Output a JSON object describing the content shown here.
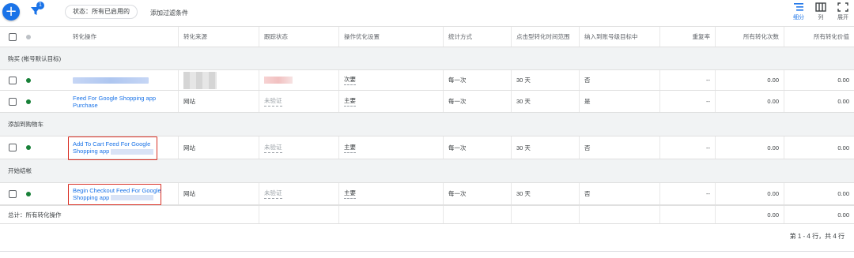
{
  "toolbar": {
    "filter_badge": "1",
    "status_chip": "状态：所有已启用的",
    "add_filter": "添加过滤条件",
    "tools": [
      {
        "label": "细分",
        "icon": "segment-icon"
      },
      {
        "label": "列",
        "icon": "columns-icon"
      },
      {
        "label": "展开",
        "icon": "expand-icon"
      }
    ]
  },
  "colors": {
    "accent": "#1a73e8",
    "status_active": "#188038",
    "highlight_box": "#d93025"
  },
  "columns": [
    "转化操作",
    "转化来源",
    "跟踪状态",
    "操作优化设置",
    "统计方式",
    "点击型转化时间范围",
    "纳入到账号级目标中",
    "重复率",
    "所有转化次数",
    "所有转化价值"
  ],
  "groups": [
    {
      "label": "购买 (帐号默认目标)",
      "rows": [
        {
          "name_line1": "",
          "name_line2": "",
          "source": "",
          "tracking": "",
          "optimization": "次要",
          "count": "每一次",
          "window": "30 天",
          "in_goal": "否",
          "repeat": "--",
          "conversions": "0.00",
          "value": "0.00"
        },
        {
          "name_line1": "Feed For Google Shopping app",
          "name_line2": "Purchase",
          "source": "网站",
          "tracking": "未验证",
          "optimization": "主要",
          "count": "每一次",
          "window": "30 天",
          "in_goal": "是",
          "repeat": "--",
          "conversions": "0.00",
          "value": "0.00"
        }
      ]
    },
    {
      "label": "添加到购物车",
      "rows": [
        {
          "name_line1": "Add To Cart Feed For Google",
          "name_line2": "Shopping app",
          "source": "网站",
          "tracking": "未验证",
          "optimization": "主要",
          "count": "每一次",
          "window": "30 天",
          "in_goal": "否",
          "repeat": "--",
          "conversions": "0.00",
          "value": "0.00"
        }
      ]
    },
    {
      "label": "开始结帐",
      "rows": [
        {
          "name_line1": "Begin Checkout Feed For Google",
          "name_line2": "Shopping app",
          "source": "网站",
          "tracking": "未验证",
          "optimization": "主要",
          "count": "每一次",
          "window": "30 天",
          "in_goal": "否",
          "repeat": "--",
          "conversions": "0.00",
          "value": "0.00"
        }
      ]
    }
  ],
  "total": {
    "label": "总计：所有转化操作",
    "conversions": "0.00",
    "value": "0.00"
  },
  "pager": "第 1 - 4 行，共 4 行"
}
